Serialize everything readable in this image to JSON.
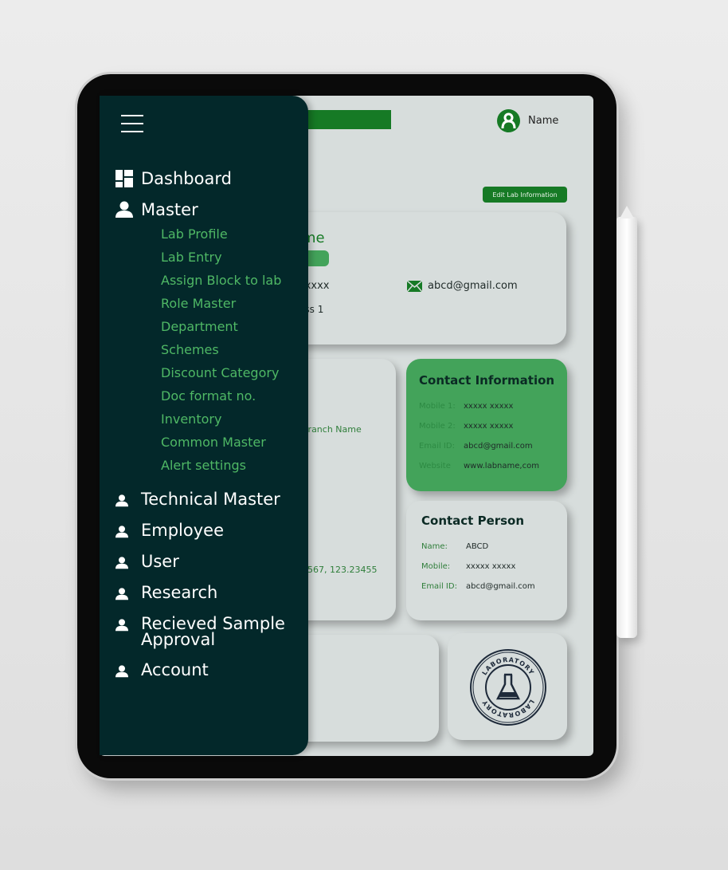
{
  "header": {
    "user_name": "Name",
    "edit_button": "Edit Lab Information",
    "user_icon": "user-circle-icon"
  },
  "lab_card": {
    "name_fragment": "me",
    "mobile_fragment": "xxxxx",
    "address_fragment": "ess 1",
    "email": "abcd@gmail.com",
    "email_icon": "envelope-icon"
  },
  "branch_card": {
    "branch_fragment": "Branch Name",
    "coords_fragment": "4567, 123.23455"
  },
  "contact_info": {
    "title": "Contact Information",
    "rows": [
      {
        "label": "Mobile 1:",
        "value": "xxxxx xxxxx"
      },
      {
        "label": "Mobile 2:",
        "value": "xxxxx xxxxx"
      },
      {
        "label": "Email ID:",
        "value": "abcd@gmail.com"
      },
      {
        "label": "Website",
        "value": "www.labname,com"
      }
    ]
  },
  "contact_person": {
    "title": "Contact Person",
    "rows": [
      {
        "label": "Name:",
        "value": "ABCD"
      },
      {
        "label": "Mobile:",
        "value": "xxxxx xxxxx"
      },
      {
        "label": "Email ID:",
        "value": "abcd@gmail.com"
      }
    ]
  },
  "stamp": {
    "text_top": "LABORATORY",
    "text_side": "TESTED",
    "icon": "flask-icon"
  },
  "sidebar": {
    "menu_icon": "hamburger-icon",
    "dashboard": "Dashboard",
    "master": "Master",
    "master_items": [
      "Lab Profile",
      "Lab Entry",
      "Assign Block to lab",
      "Role Master",
      "Department",
      "Schemes",
      "Discount Category",
      "Doc format no.",
      "Inventory",
      "Common Master",
      "Alert settings"
    ],
    "items": [
      "Technical Master",
      "Employee",
      "User",
      "Research",
      "Recieved Sample Approval",
      "Account"
    ]
  },
  "colors": {
    "sidebar": "#03282a",
    "primary": "#167a25",
    "accent": "#43a35a",
    "screen": "#d7dddc"
  }
}
